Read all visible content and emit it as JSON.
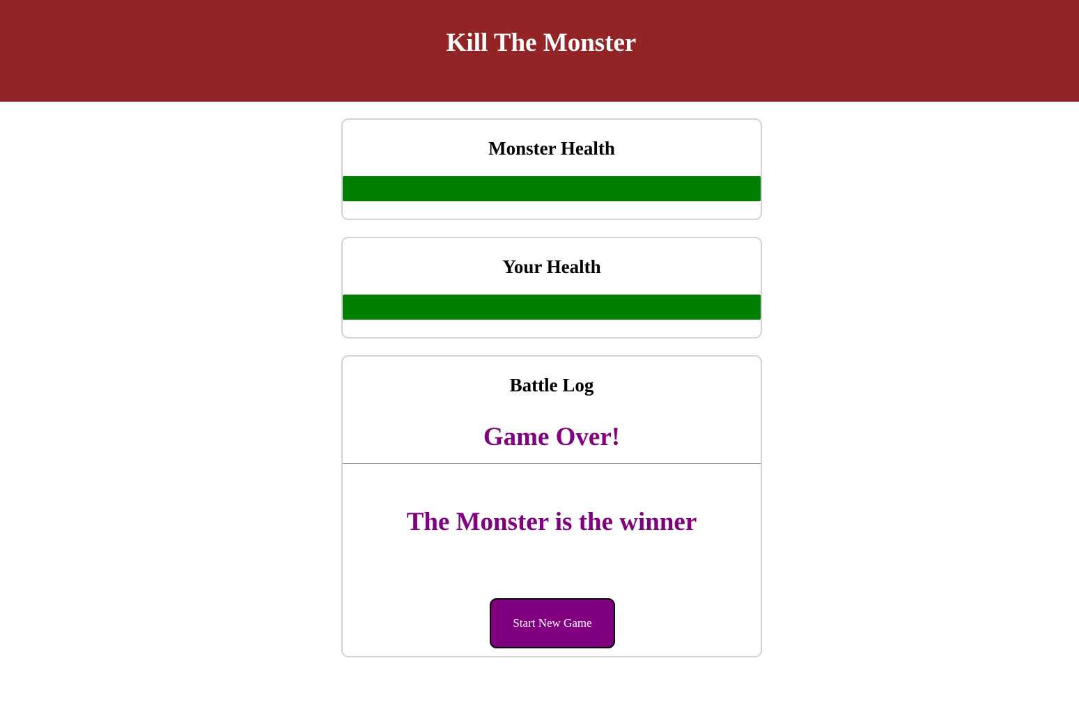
{
  "header": {
    "title": "Kill The Monster",
    "background_color": "#922426"
  },
  "monster_panel": {
    "heading": "Monster Health",
    "health_percent": 100,
    "bar_color": "#008000"
  },
  "player_panel": {
    "heading": "Your Health",
    "health_percent": 100,
    "bar_color": "#008000"
  },
  "battle_log": {
    "heading": "Battle Log",
    "game_over_text": "Game Over!",
    "winner_text": "The Monster is the winner",
    "accent_color": "#800080",
    "start_button_label": "Start New Game"
  }
}
